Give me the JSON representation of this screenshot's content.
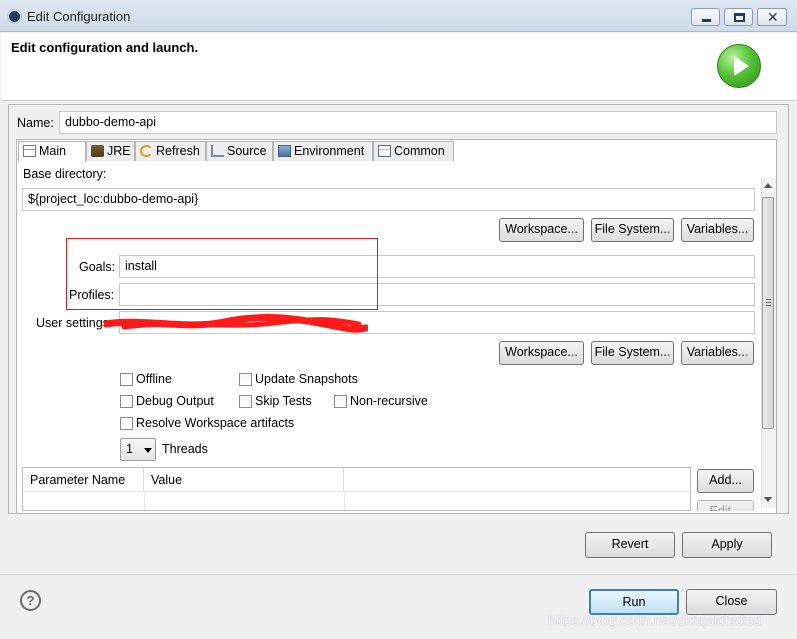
{
  "window": {
    "title": "Edit Configuration"
  },
  "header": {
    "title": "Edit configuration and launch."
  },
  "name_field": {
    "label": "Name:",
    "value": "dubbo-demo-api"
  },
  "tabs": [
    {
      "label": "Main",
      "icon": "main-tab-icon",
      "active": true
    },
    {
      "label": "JRE",
      "icon": "jre-icon",
      "active": false
    },
    {
      "label": "Refresh",
      "icon": "refresh-icon",
      "active": false
    },
    {
      "label": "Source",
      "icon": "source-icon",
      "active": false
    },
    {
      "label": "Environment",
      "icon": "environment-icon",
      "active": false
    },
    {
      "label": "Common",
      "icon": "common-icon",
      "active": false
    }
  ],
  "main": {
    "base_directory": {
      "label": "Base directory:",
      "value": "${project_loc:dubbo-demo-api}"
    },
    "dir_buttons": {
      "workspace": "Workspace...",
      "file_system": "File System...",
      "variables": "Variables..."
    },
    "goals": {
      "label": "Goals:",
      "value": "install"
    },
    "profiles": {
      "label": "Profiles:",
      "value": ""
    },
    "user_settings": {
      "label": "User settings:",
      "value": ""
    },
    "settings_buttons": {
      "workspace": "Workspace...",
      "file_system": "File System...",
      "variables": "Variables..."
    },
    "options": {
      "offline": "Offline",
      "update_snapshots": "Update Snapshots",
      "debug_output": "Debug Output",
      "skip_tests": "Skip Tests",
      "non_recursive": "Non-recursive",
      "resolve_workspace": "Resolve Workspace artifacts"
    },
    "threads": {
      "value": "1",
      "label": "Threads"
    },
    "parameters": {
      "columns": [
        "Parameter Name",
        "Value"
      ],
      "add_button": "Add...",
      "edit_button": "Edit..."
    }
  },
  "footer": {
    "revert": "Revert",
    "apply": "Apply",
    "run": "Run",
    "close": "Close"
  },
  "watermark": "https://blog.csdn.net/dkfajsldfsdlsd",
  "colors": {
    "annotation_border": "#d81b1b",
    "redaction": "#ff1a1a",
    "run_badge": "#3fae27"
  }
}
